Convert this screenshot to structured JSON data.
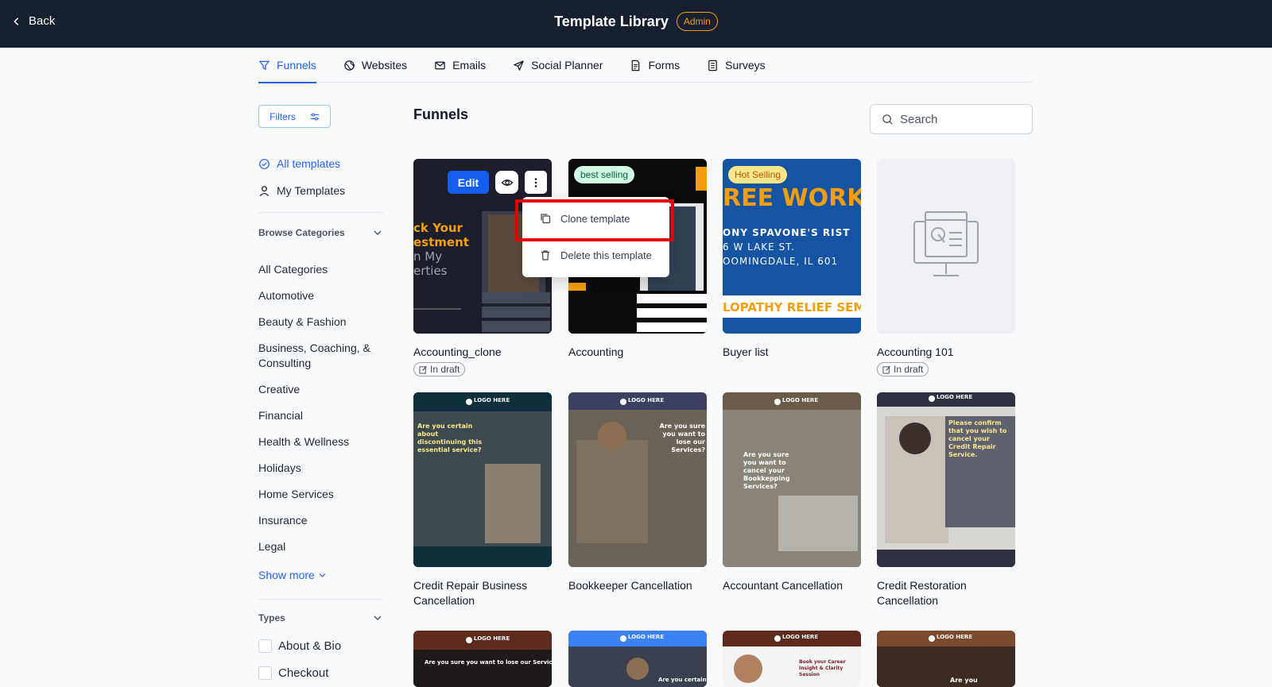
{
  "header": {
    "back_label": "Back",
    "title": "Template Library",
    "badge": "Admin"
  },
  "tabs": [
    {
      "label": "Funnels",
      "icon": "funnel-icon",
      "active": true
    },
    {
      "label": "Websites",
      "icon": "globe-icon"
    },
    {
      "label": "Emails",
      "icon": "mail-icon"
    },
    {
      "label": "Social Planner",
      "icon": "send-icon"
    },
    {
      "label": "Forms",
      "icon": "form-icon"
    },
    {
      "label": "Surveys",
      "icon": "survey-icon"
    }
  ],
  "sidebar": {
    "filters_label": "Filters",
    "all_templates": "All templates",
    "my_templates": "My Templates",
    "browse_categories": "Browse Categories",
    "categories": [
      "All Categories",
      "Automotive",
      "Beauty & Fashion",
      "Business, Coaching, & Consulting",
      "Creative",
      "Financial",
      "Health & Wellness",
      "Holidays",
      "Home Services",
      "Insurance",
      "Legal"
    ],
    "show_more": "Show more",
    "types_label": "Types",
    "types": [
      "About & Bio",
      "Checkout"
    ]
  },
  "main": {
    "title": "Funnels",
    "search_placeholder": "Search"
  },
  "cards": [
    {
      "name": "Accounting_clone",
      "draft": "In draft"
    },
    {
      "name": "Accounting",
      "badge": "best selling"
    },
    {
      "name": "Buyer list",
      "badge": "Hot Selling"
    },
    {
      "name": "Accounting 101",
      "draft": "In draft"
    },
    {
      "name": "Credit Repair Business Cancellation"
    },
    {
      "name": "Bookkeeper Cancellation"
    },
    {
      "name": "Accountant Cancellation"
    },
    {
      "name": "Credit Restoration Cancellation"
    }
  ],
  "card_actions": {
    "edit": "Edit"
  },
  "dropdown": {
    "clone": "Clone template",
    "delete": "Delete this template"
  },
  "thumb_text": {
    "accounting_lines": [
      "ck Your",
      "estment",
      "n My",
      "erties"
    ],
    "logo_here": "LOGO HERE",
    "buyer_big": "REE WORK",
    "buyer_sub1": "ONY SPAVONE'S RIST",
    "buyer_sub2": "6 W LAKE ST.",
    "buyer_sub3": "OOMINGDALE, IL 601",
    "buyer_bottom": "LOPATHY RELIEF SEM",
    "cr1": "Are you certain about discontinuing this essential service?",
    "bk1": "Are you sure you want to lose our Services?",
    "ac1": "Are you sure you want to cancel your Bookkepping Services?",
    "cs1": "Please confirm that you wish to cancel your Credit Repair Service.",
    "row3_a": "Are you sure you want to lose our Services?",
    "row3_b": "Are you certain",
    "row3_c": "Book your Career Insight & Clarity Session",
    "row3_d": "Are you"
  },
  "colors": {
    "accent": "#2563eb",
    "topbar": "#17202e",
    "highlight": "#e60000",
    "admin": "#f59e0b"
  }
}
